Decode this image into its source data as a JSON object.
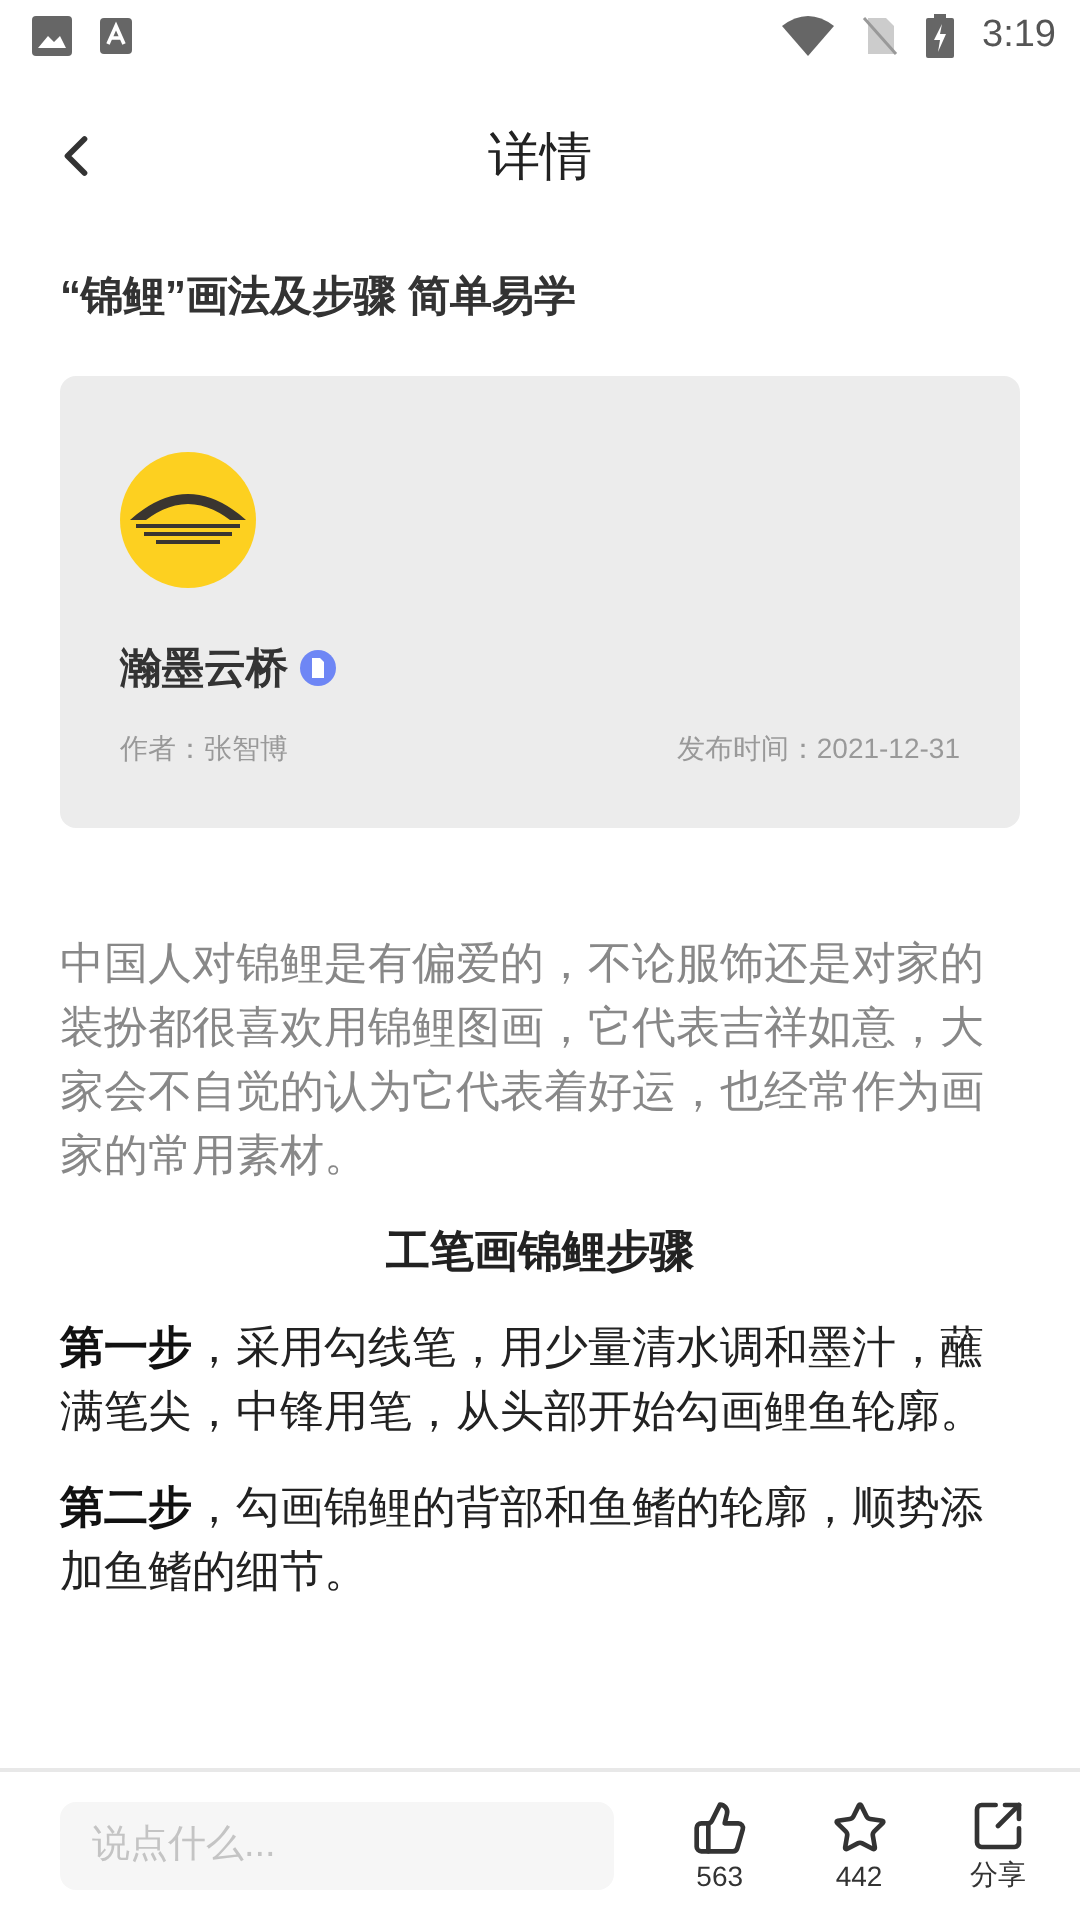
{
  "status_bar": {
    "time": "3:19"
  },
  "header": {
    "title": "详情"
  },
  "article": {
    "title": "“锦鲤”画法及步骤 简单易学",
    "author_card": {
      "name": "瀚墨云桥",
      "author": "作者：张智博",
      "published": "发布时间：2021-12-31"
    },
    "body": [
      {
        "kind": "intro",
        "text": "中国人对锦鲤是有偏爱的，不论服饰还是对家的装扮都很喜欢用锦鲤图画，它代表吉祥如意，大家会不自觉的认为它代表着好运，也经常作为画家的常用素材。"
      },
      {
        "kind": "heading",
        "text": "工笔画锦鲤步骤"
      },
      {
        "kind": "step",
        "text": "**第一步**，采用勾线笔，用少量清水调和墨汁，蘸满笔尖，中锋用笔，从头部开始勾画鲤鱼轮廓。"
      },
      {
        "kind": "step",
        "text": "**第二步**，勾画锦鲤的背部和鱼鳍的轮廓，顺势添加鱼鳍的细节。"
      }
    ]
  },
  "bottom_bar": {
    "comment": {
      "placeholder": "说点什么..."
    },
    "actions": [
      {
        "kind": "like",
        "label": "563"
      },
      {
        "kind": "favorite",
        "label": "442"
      },
      {
        "kind": "share",
        "label": "分享"
      }
    ]
  }
}
